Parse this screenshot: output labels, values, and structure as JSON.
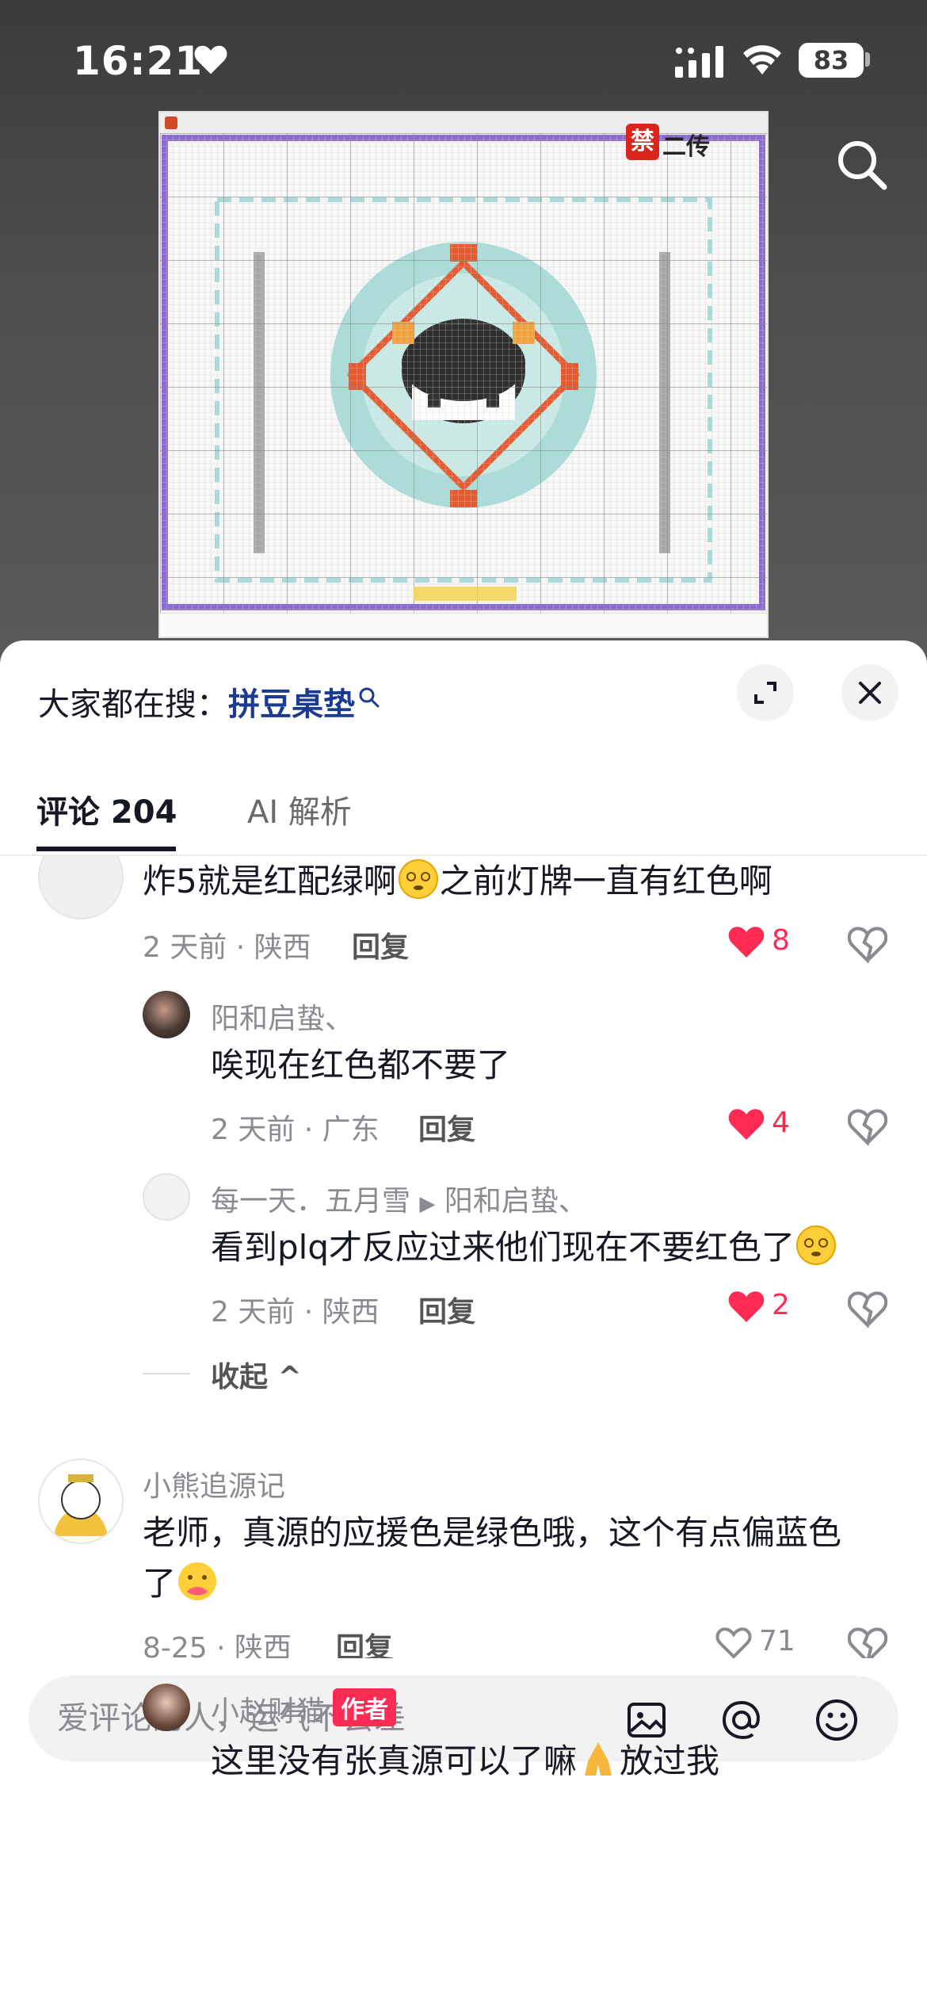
{
  "status_bar": {
    "time": "16:21",
    "battery": "83"
  },
  "sheet": {
    "hot_search_prefix": "大家都在搜：",
    "hot_search_keyword": "拼豆桌垫",
    "tabs": [
      {
        "label": "评论 204",
        "active": true
      },
      {
        "label": "AI 解析",
        "active": false
      }
    ]
  },
  "comments": [
    {
      "text": "炸5就是红配绿啊",
      "emoji": "dizzy-face",
      "text_after": "之前灯牌一直有红色啊",
      "meta": "2 天前 · 陕西",
      "reply": "回复",
      "likes": "8",
      "liked": true
    }
  ],
  "replies_a": [
    {
      "user": "阳和启蛰、",
      "text": "唉现在红色都不要了",
      "meta": "2 天前 · 广东",
      "reply": "回复",
      "likes": "4",
      "liked": true
    },
    {
      "user": "每一天．五月雪",
      "reply_to": "阳和启蛰、",
      "text": "看到plq才反应过来他们现在不要红色了",
      "meta": "2 天前 · 陕西",
      "reply": "回复",
      "likes": "2",
      "liked": true
    }
  ],
  "collapse_label": "收起",
  "comment_b": {
    "user": "小熊追源记",
    "text_line1": "老师，真源的应援色是绿色哦，这个有点偏蓝色",
    "text_line2": "了",
    "meta": "8-25 · 陕西",
    "reply": "回复",
    "likes": "71",
    "liked": false
  },
  "reply_b": {
    "user": "小赵财猫",
    "tag": "作者",
    "text": "这里没有张真源可以了嘛",
    "text_after": "放过我"
  },
  "input": {
    "placeholder": "爱评论的人，运气不会差"
  },
  "colors": {
    "like_red": "#fe2c55",
    "keyword_blue": "#1a3b8f",
    "muted_text": "#8a8b91"
  },
  "icons": [
    "heart-icon",
    "signal-icon",
    "wifi-icon",
    "search-icon",
    "expand-icon",
    "close-icon",
    "dislike-icon",
    "image-icon",
    "at-icon",
    "emoji-icon"
  ]
}
